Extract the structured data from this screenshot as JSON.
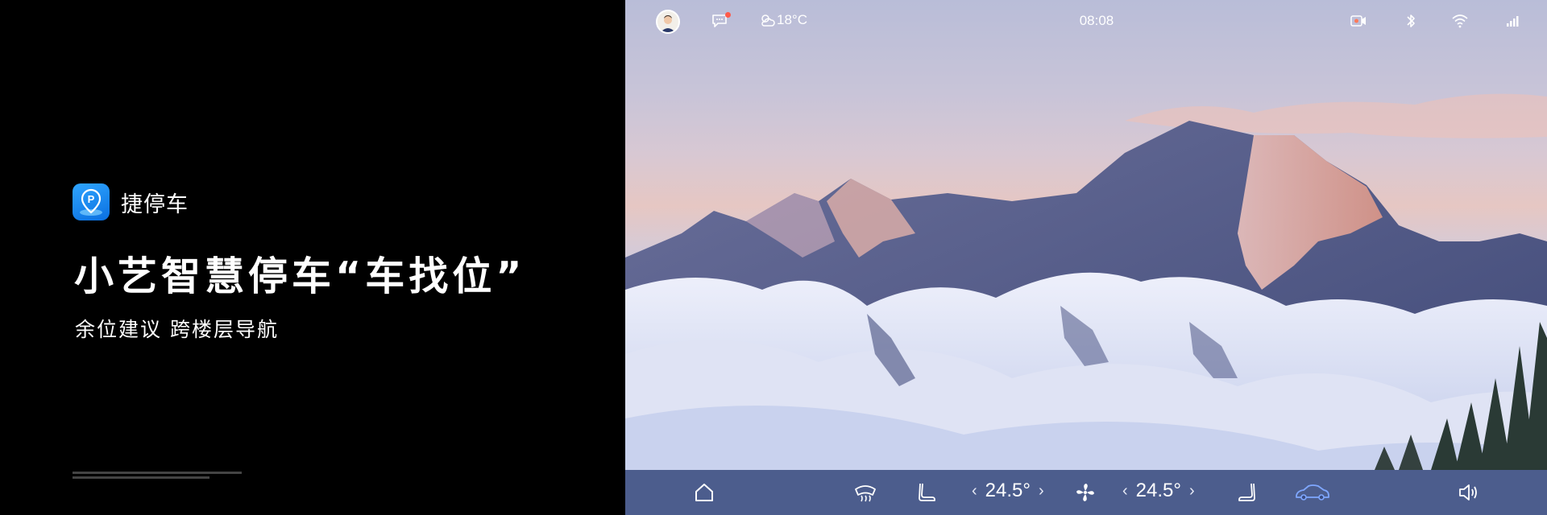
{
  "promo": {
    "app_icon": "parking-location-icon",
    "app_name": "捷停车",
    "headline": "小艺智慧停车“车找位”",
    "subline": "余位建议 跨楼层导航"
  },
  "status_bar": {
    "temperature": "18°C",
    "time": "08:08",
    "icons": [
      "avatar",
      "message-icon",
      "weather-icon",
      "recording-icon",
      "bluetooth-icon",
      "wifi-icon",
      "signal-icon"
    ],
    "notification_color": "#ff5a4a"
  },
  "dock": {
    "driver_temp": "24.5°",
    "passenger_temp": "24.5°",
    "icons": [
      "home-icon",
      "defrost-icon",
      "driver-seat-icon",
      "fan-icon",
      "passenger-seat-icon",
      "car-icon",
      "volume-icon"
    ],
    "active_color": "#7fa7ff"
  },
  "colors": {
    "dock_background": "#3a4c80",
    "app_icon_accent": "#1f8cf5"
  }
}
